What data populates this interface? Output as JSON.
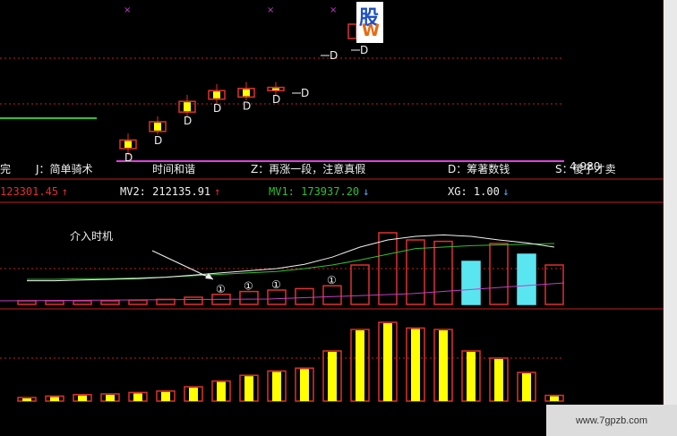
{
  "strategy": {
    "items": [
      {
        "text": "完",
        "color": "#f0f0f0"
      },
      {
        "text": "J：简单骑术",
        "color": "#f0f0f0"
      },
      {
        "text": "时间和谐",
        "color": "#f0f0f0"
      },
      {
        "text": "Z：再涨一段，注意真假",
        "color": "#f0f0f0"
      },
      {
        "text": "D：筹著数钱",
        "color": "#f0f0f0"
      },
      {
        "text": "S：傻子才卖",
        "color": "#f0f0f0"
      }
    ],
    "price_tag": "4.980"
  },
  "indicators": [
    {
      "label": "123301.45",
      "arrow": "↑",
      "color": "#e03030",
      "arrow_color": "#e03030"
    },
    {
      "label": "MV2: 212135.91",
      "arrow": "↑",
      "color": "#f0f0f0",
      "arrow_color": "#e03030"
    },
    {
      "label": "MV1: 173937.20",
      "arrow": "↓",
      "color": "#30c030",
      "arrow_color": "#50b0ff"
    },
    {
      "label": "XG: 1.00",
      "arrow": "↓",
      "color": "#f0f0f0",
      "arrow_color": "#50b0ff"
    }
  ],
  "annotation": "介入时机",
  "marker_letter": "D",
  "circle_mark": "①",
  "logo": {
    "top": "股",
    "bottom": "W"
  },
  "watermark": "www.7gpzb.com",
  "colors": {
    "up": "#e03030",
    "down_fill": "#5ae6f0",
    "yellow": "#ffff00",
    "mv_green": "#30c030",
    "mv_white": "#f0f0f0",
    "mv_purple": "#c040c0",
    "magenta": "#e040e0",
    "grid": "#c02020"
  },
  "chart_data": [
    {
      "type": "candlestick",
      "title": "",
      "markers": "D",
      "candles": [
        {
          "open": 4.2,
          "close": 4.28,
          "high": 4.34,
          "low": 4.14
        },
        {
          "open": 4.36,
          "close": 4.45,
          "high": 4.5,
          "low": 4.33
        },
        {
          "open": 4.54,
          "close": 4.64,
          "high": 4.7,
          "low": 4.5
        },
        {
          "open": 4.66,
          "close": 4.74,
          "high": 4.8,
          "low": 4.62
        },
        {
          "open": 4.68,
          "close": 4.76,
          "high": 4.82,
          "low": 4.65
        },
        {
          "open": 4.74,
          "close": 4.77,
          "high": 4.82,
          "low": 4.7
        }
      ],
      "upper_candles": [
        {
          "open": 6.35,
          "close": 6.55,
          "high": 6.6,
          "low": 6.3
        }
      ]
    },
    {
      "type": "bar",
      "title": "",
      "series": [
        {
          "name": "MV2",
          "values": [
            0.35,
            0.35,
            0.36,
            0.36,
            0.37,
            0.38,
            0.4,
            0.42,
            0.44,
            0.46,
            0.5,
            0.55,
            0.62,
            0.7,
            0.78,
            0.8,
            0.82,
            0.83,
            0.84,
            0.85
          ]
        },
        {
          "name": "MV1",
          "values": [
            0.33,
            0.33,
            0.34,
            0.35,
            0.36,
            0.38,
            0.41,
            0.44,
            0.47,
            0.5,
            0.56,
            0.66,
            0.8,
            0.9,
            0.95,
            0.97,
            0.95,
            0.9,
            0.86,
            0.8
          ]
        }
      ],
      "bars": [
        0.05,
        0.05,
        0.05,
        0.05,
        0.06,
        0.07,
        0.1,
        0.14,
        0.18,
        0.2,
        0.22,
        0.26,
        0.55,
        1.0,
        0.9,
        0.88,
        0.6,
        0.85,
        0.7,
        0.55
      ],
      "bar_kind": [
        "up",
        "up",
        "up",
        "up",
        "up",
        "up",
        "up",
        "up",
        "up",
        "up",
        "up",
        "up",
        "up",
        "up",
        "up",
        "up",
        "down",
        "up",
        "down",
        "up"
      ],
      "circle_marks_at": [
        7,
        8,
        9,
        11
      ]
    },
    {
      "type": "bar",
      "title": "",
      "values": [
        0.05,
        0.07,
        0.09,
        0.1,
        0.12,
        0.14,
        0.2,
        0.28,
        0.36,
        0.42,
        0.46,
        0.7,
        1.0,
        1.1,
        1.02,
        1.0,
        0.7,
        0.6,
        0.4,
        0.08
      ]
    }
  ]
}
